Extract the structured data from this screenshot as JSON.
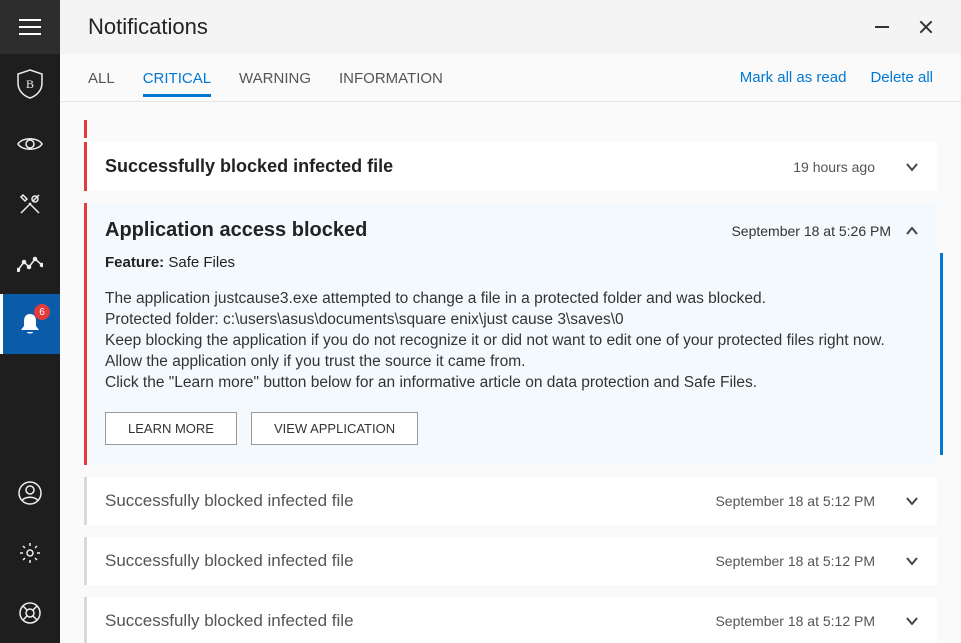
{
  "title": "Notifications",
  "window": {
    "minimize_label": "Minimize",
    "close_label": "Close"
  },
  "sidebar": {
    "menu_label": "Menu",
    "badge_count": "6",
    "items": {
      "shield": "Protection",
      "privacy": "Privacy",
      "tools": "Tools",
      "activity": "Activity",
      "notifications": "Notifications",
      "account": "Account",
      "settings": "Settings",
      "support": "Support"
    }
  },
  "tabs": {
    "all": "ALL",
    "critical": "CRITICAL",
    "warning": "WARNING",
    "information": "INFORMATION",
    "active": "critical"
  },
  "actions": {
    "mark_all": "Mark all as read",
    "delete_all": "Delete all"
  },
  "notifications": [
    {
      "id": "n1",
      "title": "Successfully blocked infected file",
      "time": "19 hours ago",
      "severity": "critical",
      "expanded": false,
      "read": false
    },
    {
      "id": "n2",
      "title": "Application access blocked",
      "time": "September 18 at 5:26 PM",
      "severity": "critical",
      "expanded": true,
      "read": false,
      "feature_label": "Feature:",
      "feature_value": "Safe Files",
      "body": "The application justcause3.exe attempted to change a file in a protected folder and was blocked.\nProtected folder: c:\\users\\asus\\documents\\square enix\\just cause 3\\saves\\0\nKeep blocking the application if you do not recognize it or did not want to edit one of your protected files right now. Allow the application only if you trust the source it came from.\nClick the \"Learn more\" button below for an informative article on data protection and Safe Files.",
      "buttons": {
        "learn_more": "LEARN MORE",
        "view_app": "VIEW APPLICATION"
      }
    },
    {
      "id": "n3",
      "title": "Successfully blocked infected file",
      "time": "September 18 at 5:12 PM",
      "severity": "critical",
      "expanded": false,
      "read": true
    },
    {
      "id": "n4",
      "title": "Successfully blocked infected file",
      "time": "September 18 at 5:12 PM",
      "severity": "critical",
      "expanded": false,
      "read": true
    },
    {
      "id": "n5",
      "title": "Successfully blocked infected file",
      "time": "September 18 at 5:12 PM",
      "severity": "critical",
      "expanded": false,
      "read": true
    }
  ]
}
